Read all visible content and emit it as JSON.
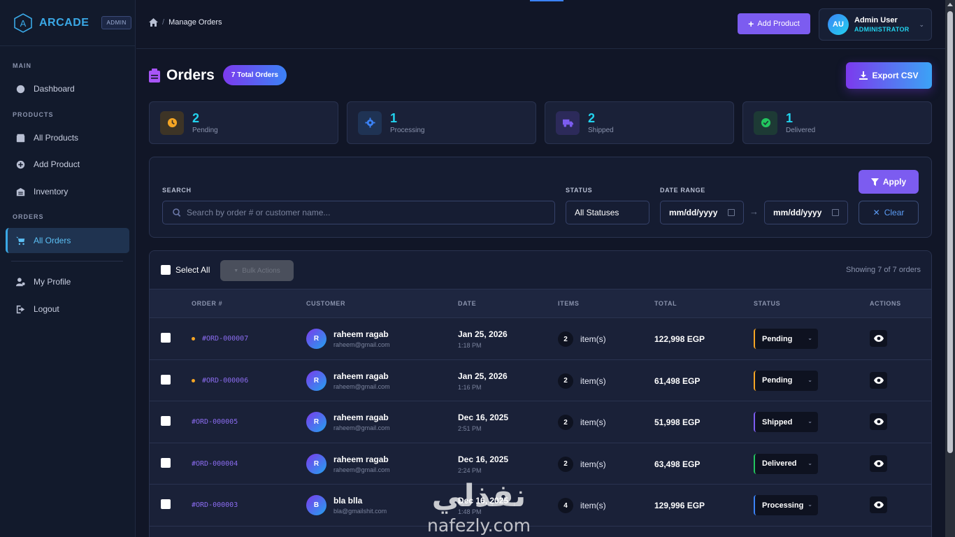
{
  "sidebar": {
    "brand_name": "ARCADE",
    "brand_badge": "ADMIN",
    "sections": {
      "main": "MAIN",
      "products": "PRODUCTS",
      "orders": "ORDERS"
    },
    "items": {
      "dashboard": "Dashboard",
      "all_products": "All Products",
      "add_product": "Add Product",
      "inventory": "Inventory",
      "all_orders": "All Orders",
      "my_profile": "My Profile",
      "logout": "Logout"
    }
  },
  "topbar": {
    "breadcrumb": "Manage Orders",
    "add_product": "Add Product",
    "user": {
      "initials": "AU",
      "name": "Admin User",
      "role": "ADMINISTRATOR"
    }
  },
  "page": {
    "title": "Orders",
    "total_badge": "7 Total Orders",
    "export": "Export CSV"
  },
  "stats": [
    {
      "value": "2",
      "label": "Pending",
      "color": "#f5a524"
    },
    {
      "value": "1",
      "label": "Processing",
      "color": "#3b82f6"
    },
    {
      "value": "2",
      "label": "Shipped",
      "color": "#7c5cf0"
    },
    {
      "value": "1",
      "label": "Delivered",
      "color": "#22c55e"
    }
  ],
  "filters": {
    "search_label": "SEARCH",
    "search_placeholder": "Search by order # or customer name...",
    "status_label": "STATUS",
    "status_value": "All Statuses",
    "date_label": "DATE RANGE",
    "date_from": "mm/dd/yyyy",
    "date_to": "mm/dd/yyyy",
    "arrow": "→",
    "apply": "Apply",
    "clear": "Clear"
  },
  "table": {
    "select_all": "Select All",
    "bulk_actions": "Bulk Actions",
    "showing": "Showing 7 of 7 orders",
    "headers": {
      "order": "ORDER #",
      "customer": "CUSTOMER",
      "date": "DATE",
      "items": "ITEMS",
      "total": "TOTAL",
      "status": "STATUS",
      "actions": "ACTIONS"
    },
    "items_suffix": "item(s)",
    "rows": [
      {
        "order": "#ORD-000007",
        "initial": "R",
        "name": "raheem ragab",
        "email": "raheem@gmail.com",
        "date": "Jan 25, 2026",
        "time": "1:18 PM",
        "items": "2",
        "total": "122,998 EGP",
        "status": "Pending"
      },
      {
        "order": "#ORD-000006",
        "initial": "R",
        "name": "raheem ragab",
        "email": "raheem@gmail.com",
        "date": "Jan 25, 2026",
        "time": "1:16 PM",
        "items": "2",
        "total": "61,498 EGP",
        "status": "Pending"
      },
      {
        "order": "#ORD-000005",
        "initial": "R",
        "name": "raheem ragab",
        "email": "raheem@gmail.com",
        "date": "Dec 16, 2025",
        "time": "2:51 PM",
        "items": "2",
        "total": "51,998 EGP",
        "status": "Shipped"
      },
      {
        "order": "#ORD-000004",
        "initial": "R",
        "name": "raheem ragab",
        "email": "raheem@gmail.com",
        "date": "Dec 16, 2025",
        "time": "2:24 PM",
        "items": "2",
        "total": "63,498 EGP",
        "status": "Delivered"
      },
      {
        "order": "#ORD-000003",
        "initial": "B",
        "name": "bla blla",
        "email": "bla@gmailshit.com",
        "date": "Dec 16, 2025",
        "time": "1:48 PM",
        "items": "4",
        "total": "129,996 EGP",
        "status": "Processing"
      }
    ]
  },
  "watermark": {
    "arabic": "نفذلي",
    "latin": "nafezly.com"
  }
}
